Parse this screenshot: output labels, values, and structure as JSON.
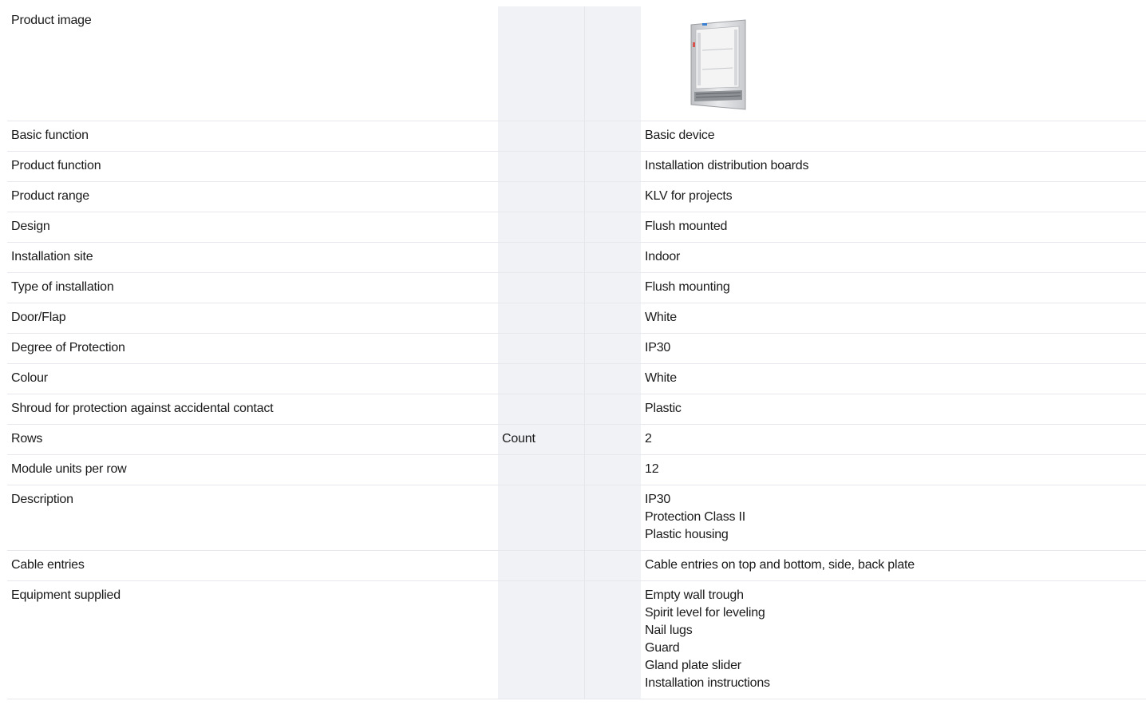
{
  "image": {
    "icon": "distribution-board-enclosure-image"
  },
  "rows": [
    {
      "label": "Basic function",
      "unit": "",
      "value": "Basic device"
    },
    {
      "label": "Product function",
      "unit": "",
      "value": "Installation distribution boards"
    },
    {
      "label": "Product range",
      "unit": "",
      "value": "KLV for projects"
    },
    {
      "label": "Design",
      "unit": "",
      "value": "Flush mounted"
    },
    {
      "label": "Installation site",
      "unit": "",
      "value": "Indoor"
    },
    {
      "label": "Type of installation",
      "unit": "",
      "value": "Flush mounting"
    },
    {
      "label": "Door/Flap",
      "unit": "",
      "value": "White"
    },
    {
      "label": "Degree of Protection",
      "unit": "",
      "value": "IP30"
    },
    {
      "label": "Colour",
      "unit": "",
      "value": "White"
    },
    {
      "label": "Shroud for protection against accidental contact",
      "unit": "",
      "value": "Plastic"
    },
    {
      "label": "Rows",
      "unit": "Count",
      "value": "2"
    },
    {
      "label": "Module units per row",
      "unit": "",
      "value": "12"
    }
  ],
  "product_image_label": "Product image",
  "description": {
    "label": "Description",
    "lines": [
      "IP30",
      "Protection Class II",
      "Plastic housing"
    ]
  },
  "cable_entries": {
    "label": "Cable entries",
    "value": "Cable entries on top and bottom, side, back plate"
  },
  "equipment": {
    "label": "Equipment supplied",
    "lines": [
      "Empty wall trough",
      "Spirit level for leveling",
      "Nail lugs",
      "Guard",
      "Gland plate slider",
      "Installation instructions"
    ]
  },
  "colors": {
    "accent": "#1a73c8",
    "unit_column_bg": "#f1f2f6",
    "row_border": "#e6e8ee"
  }
}
